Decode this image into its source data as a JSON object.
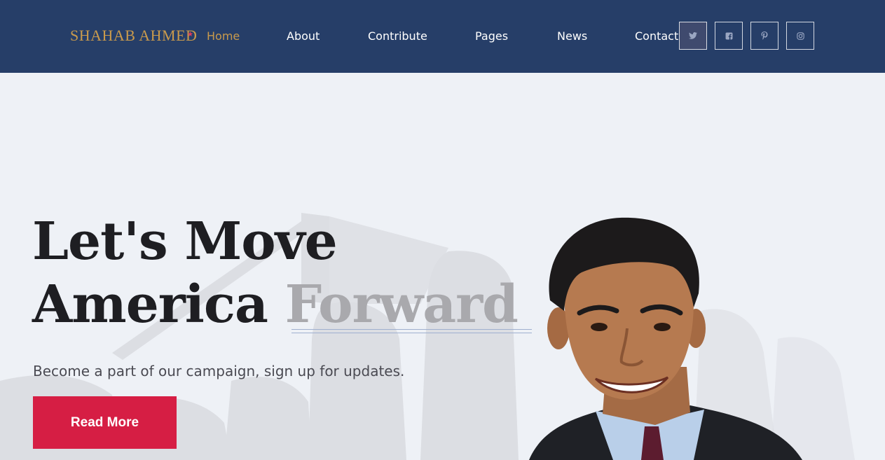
{
  "header": {
    "logo_text": "SHAHAB AHMED",
    "nav": [
      {
        "label": "Home",
        "active": true
      },
      {
        "label": "About",
        "active": false
      },
      {
        "label": "Contribute",
        "active": false
      },
      {
        "label": "Pages",
        "active": false
      },
      {
        "label": "News",
        "active": false
      },
      {
        "label": "Contact",
        "active": false
      }
    ],
    "social_icons": [
      "twitter-icon",
      "facebook-icon",
      "pinterest-icon",
      "instagram-icon"
    ]
  },
  "hero": {
    "headline_line1": "Let's Move",
    "headline_line2_prefix": "America ",
    "headline_line2_accent": "Forward",
    "subtitle": "Become a part of our campaign, sign up for updates.",
    "cta_label": "Read More"
  },
  "colors": {
    "header_bg": "#263e68",
    "accent_gold": "#c99a4c",
    "cta_red": "#d61e44",
    "hero_bg": "#eef1f6",
    "accent_gray": "#a9a9ad"
  }
}
